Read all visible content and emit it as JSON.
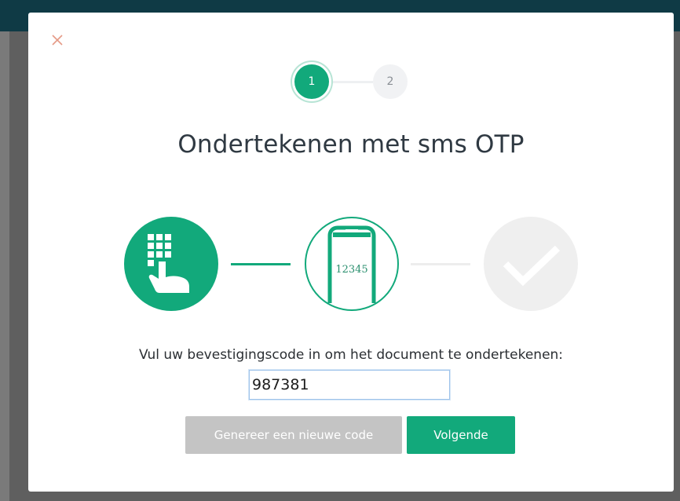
{
  "modal": {
    "close_icon": "close-icon",
    "stepper": {
      "step1": "1",
      "step2": "2",
      "active_step": 1
    },
    "title": "Ondertekenen met sms OTP",
    "illustration": {
      "icons": [
        "keypad-hand-icon",
        "phone-icon",
        "checkmark-icon"
      ],
      "phone_code": "12345"
    },
    "prompt": "Vul uw bevestigingscode in om het document te ondertekenen:",
    "code_input": {
      "value": "987381",
      "placeholder": ""
    },
    "buttons": {
      "new_code": "Genereer een nieuwe code",
      "next": "Volgende"
    }
  },
  "colors": {
    "accent": "#12a97b",
    "topbar": "#0f3a45",
    "disabled_button": "#c4c4c4",
    "close": "#e59a86"
  }
}
